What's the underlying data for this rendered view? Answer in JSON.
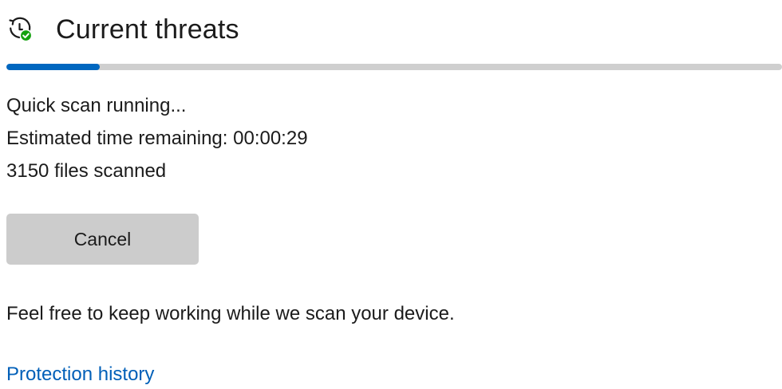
{
  "header": {
    "icon": "history-shield-check-icon",
    "title": "Current threats"
  },
  "scan": {
    "progress_fraction": 0.12,
    "status": "Quick scan running...",
    "time_label": "Estimated time remaining:",
    "time_value": "00:00:29",
    "files_count": "3150",
    "files_label": "files scanned"
  },
  "actions": {
    "cancel_label": "Cancel"
  },
  "info": {
    "message": "Feel free to keep working while we scan your device."
  },
  "links": {
    "protection_history": "Protection history"
  },
  "colors": {
    "accent": "#0067c0",
    "link": "#005fb8",
    "track": "#cfcfcf",
    "button": "#cccccc",
    "check_badge": "#13a10e"
  }
}
